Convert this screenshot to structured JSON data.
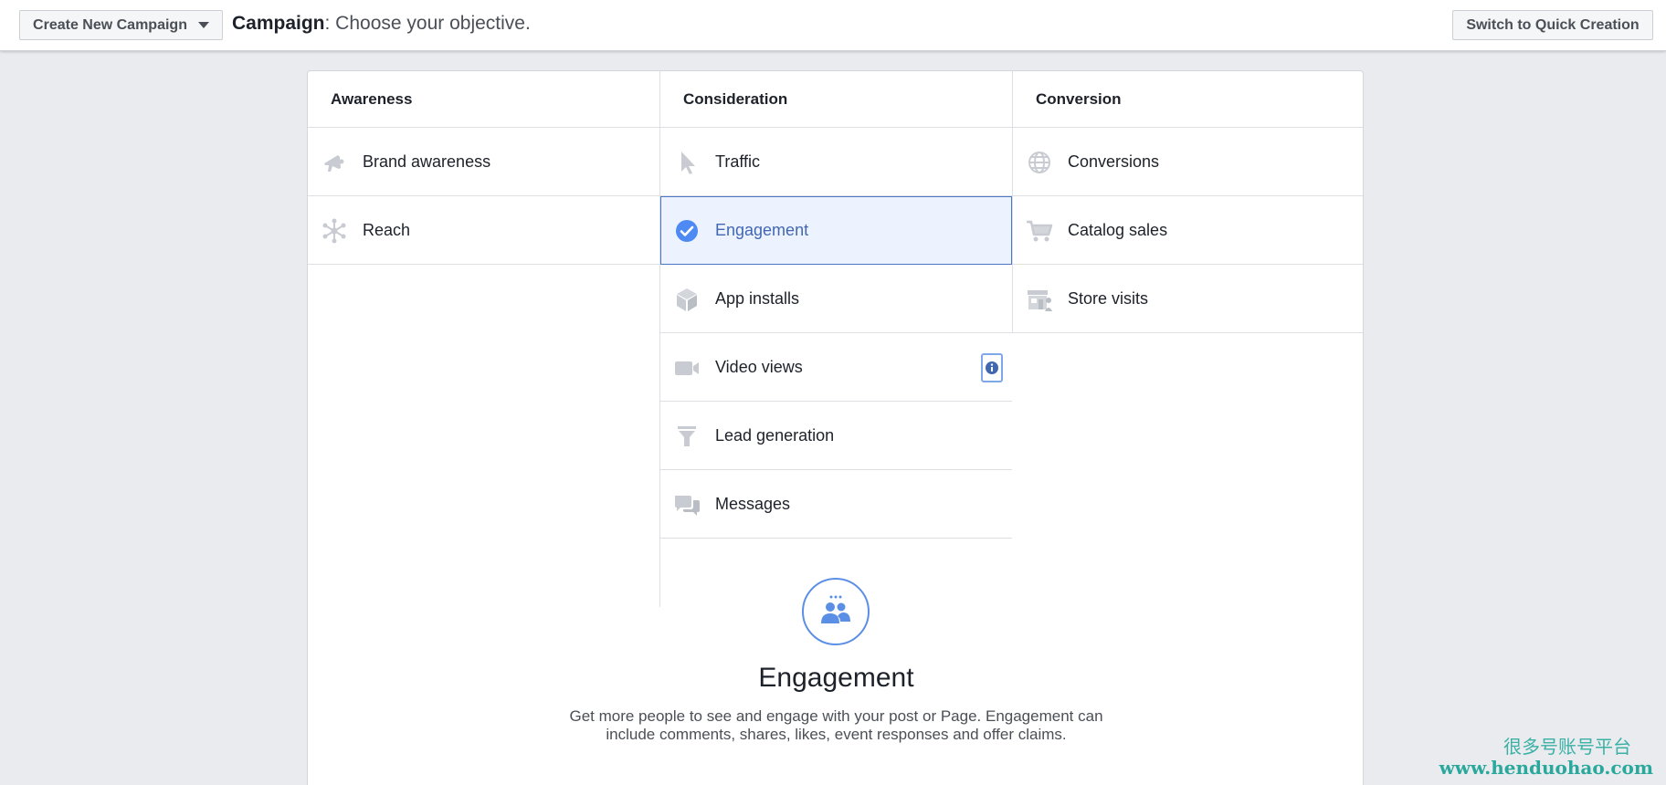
{
  "toolbar": {
    "create_label": "Create New Campaign",
    "title_bold": "Campaign",
    "title_rest": ": Choose your objective.",
    "quick_label": "Switch to Quick Creation"
  },
  "columns": {
    "awareness": {
      "header": "Awareness",
      "items": [
        {
          "label": "Brand awareness",
          "icon": "megaphone-icon"
        },
        {
          "label": "Reach",
          "icon": "reach-icon"
        }
      ]
    },
    "consideration": {
      "header": "Consideration",
      "items": [
        {
          "label": "Traffic",
          "icon": "cursor-icon"
        },
        {
          "label": "Engagement",
          "icon": "check-circle-icon",
          "selected": true
        },
        {
          "label": "App installs",
          "icon": "box-icon"
        },
        {
          "label": "Video views",
          "icon": "video-camera-icon"
        },
        {
          "label": "Lead generation",
          "icon": "funnel-icon"
        },
        {
          "label": "Messages",
          "icon": "chat-bubbles-icon"
        }
      ]
    },
    "conversion": {
      "header": "Conversion",
      "items": [
        {
          "label": "Conversions",
          "icon": "globe-icon"
        },
        {
          "label": "Catalog sales",
          "icon": "cart-icon"
        },
        {
          "label": "Store visits",
          "icon": "store-icon"
        }
      ]
    }
  },
  "description": {
    "title": "Engagement",
    "text": "Get more people to see and engage with your post or Page. Engagement can include comments, shares, likes, event responses and offer claims.",
    "icon": "people-icon"
  },
  "watermark": {
    "line1": "很多号账号平台",
    "line2": "www.henduohao.com"
  },
  "colors": {
    "accent": "#4267b2",
    "selected_bg": "#ecf3ff",
    "icon_gray": "#bec3c9",
    "watermark": "#2aa89c"
  }
}
